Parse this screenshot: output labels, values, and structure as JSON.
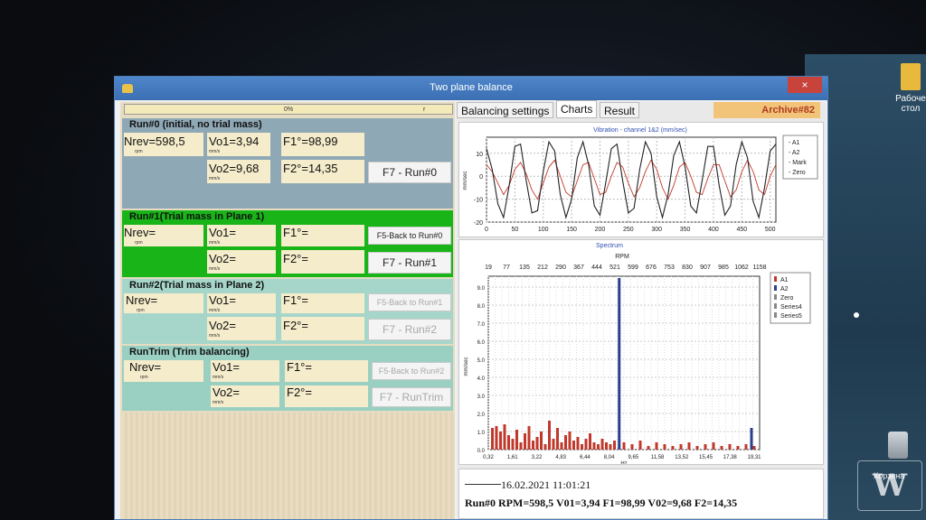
{
  "window": {
    "title": "Two plane balance",
    "close_label": "×"
  },
  "desktop": {
    "icon_label_line1": "Рабоче",
    "icon_label_line2": "стол",
    "recycle_label": "Корзина"
  },
  "progress": {
    "value_percent": 0,
    "label": "0%",
    "tick": "r"
  },
  "run0": {
    "header": "Run#0 (initial, no trial mass)",
    "nrev_label": "Nrev=598,5",
    "nrev_unit": "rpm",
    "vo1_label": "Vo1=",
    "vo1_value": "3,94",
    "vo1_unit": "mm/s",
    "f1_label": "F1°=",
    "f1_value": "98,99",
    "vo2_label": "Vo2=",
    "vo2_value": "9,68",
    "vo2_unit": "mm/s",
    "f2_label": "F2°=",
    "f2_value": "14,35",
    "run_button": "F7 - Run#0"
  },
  "run1": {
    "header": "Run#1(Trial mass in Plane 1)",
    "nrev_label": "Nrev=",
    "nrev_unit": "rpm",
    "vo1_label": "Vo1=",
    "vo1_unit": "mm/s",
    "f1_label": "F1°=",
    "vo2_label": "Vo2=",
    "vo2_unit": "mm/s",
    "f2_label": "F2°=",
    "back_button": "F5-Back to Run#0",
    "run_button": "F7 - Run#1"
  },
  "run2": {
    "header": "Run#2(Trial mass in Plane 2)",
    "nrev_label": "Nrev=",
    "nrev_unit": "rpm",
    "vo1_label": "Vo1=",
    "vo1_unit": "mm/s",
    "f1_label": "F1°=",
    "vo2_label": "Vo2=",
    "vo2_unit": "mm/s",
    "f2_label": "F2°=",
    "back_button": "F5-Back to Run#1",
    "run_button": "F7 - Run#2"
  },
  "runtrim": {
    "header": "RunTrim (Trim balancing)",
    "nrev_label": "Nrev=",
    "nrev_unit": "rpm",
    "vo1_label": "Vo1=",
    "vo1_unit": "mm/s",
    "f1_label": "F1°=",
    "vo2_label": "Vo2=",
    "vo2_unit": "mm/s",
    "f2_label": "F2°=",
    "back_button": "F5-Back to Run#2",
    "run_button": "F7 - RunTrim"
  },
  "tabs": [
    {
      "label": "Balancing settings"
    },
    {
      "label": "Charts"
    },
    {
      "label": "Result"
    }
  ],
  "archive_label": "Archive#82",
  "colors": {
    "series_a1": "#c0392b",
    "series_a2": "#2b3f8f",
    "accent_green": "#18b418"
  },
  "chart_data": [
    {
      "type": "line",
      "title": "Vibration - channel 1&2 (mm/sec)",
      "ylabel": "mm/sec",
      "xlim": [
        0,
        510
      ],
      "ylim": [
        -20,
        17
      ],
      "x_ticks": [
        0,
        50,
        100,
        150,
        200,
        250,
        300,
        350,
        400,
        450,
        500
      ],
      "y_ticks": [
        10,
        0,
        -10,
        -20
      ],
      "legend": [
        "A1",
        "A2",
        "Mark",
        "Zero"
      ],
      "legend_position": "right",
      "grid": true,
      "series": [
        {
          "name": "A1",
          "x": [
            0,
            10,
            20,
            30,
            40,
            50,
            60,
            70,
            80,
            90,
            100,
            110,
            120,
            130,
            140,
            150,
            160,
            170,
            180,
            190,
            200,
            210,
            220,
            230,
            240,
            250,
            260,
            270,
            280,
            290,
            300,
            310,
            320,
            330,
            340,
            350,
            360,
            370,
            380,
            390,
            400,
            410,
            420,
            430,
            440,
            450,
            460,
            470,
            480,
            490,
            500,
            510
          ],
          "values": [
            5,
            2,
            -3,
            -8,
            -4,
            3,
            6,
            1,
            -6,
            -10,
            -3,
            4,
            7,
            0,
            -7,
            -9,
            -2,
            5,
            6,
            -1,
            -8,
            -7,
            0,
            6,
            4,
            -3,
            -9,
            -5,
            2,
            7,
            3,
            -5,
            -10,
            -4,
            4,
            6,
            0,
            -7,
            -8,
            -1,
            5,
            5,
            -2,
            -9,
            -6,
            2,
            7,
            2,
            -6,
            -8,
            0,
            5
          ]
        },
        {
          "name": "A2",
          "x": [
            0,
            10,
            20,
            30,
            40,
            50,
            60,
            70,
            80,
            90,
            100,
            110,
            120,
            130,
            140,
            150,
            160,
            170,
            180,
            190,
            200,
            210,
            220,
            230,
            240,
            250,
            260,
            270,
            280,
            290,
            300,
            310,
            320,
            330,
            340,
            350,
            360,
            370,
            380,
            390,
            400,
            410,
            420,
            430,
            440,
            450,
            460,
            470,
            480,
            490,
            500,
            510
          ],
          "values": [
            12,
            3,
            -12,
            -18,
            -4,
            13,
            14,
            -2,
            -16,
            -15,
            2,
            15,
            11,
            -8,
            -18,
            -10,
            8,
            15,
            5,
            -13,
            -17,
            -3,
            12,
            14,
            -2,
            -16,
            -14,
            3,
            15,
            10,
            -9,
            -18,
            -8,
            9,
            15,
            4,
            -13,
            -16,
            -2,
            13,
            13,
            -4,
            -17,
            -13,
            5,
            15,
            8,
            -11,
            -18,
            -5,
            11,
            14
          ]
        }
      ]
    },
    {
      "type": "bar",
      "title": "Spectrum",
      "xlabel": "Hz",
      "ylabel": "mm/sec",
      "top_axis_label": "RPM",
      "top_ticks": [
        "19",
        "77",
        "135",
        "212",
        "290",
        "367",
        "444",
        "521",
        "599",
        "676",
        "753",
        "830",
        "907",
        "985",
        "1062",
        "1158"
      ],
      "bottom_ticks": [
        "0,32",
        "1,61",
        "3,22",
        "4,83",
        "6,44",
        "8,04",
        "9,65",
        "11,58",
        "13,52",
        "15,45",
        "17,38",
        "19,31"
      ],
      "xlim": [
        0,
        20
      ],
      "ylim": [
        0,
        9.6
      ],
      "y_ticks": [
        0.0,
        1.0,
        2.0,
        3.0,
        4.0,
        5.0,
        6.0,
        7.0,
        8.0,
        9.0
      ],
      "legend": [
        "A1",
        "A2",
        "Zero",
        "Series4",
        "Series5"
      ],
      "legend_position": "right",
      "grid": true,
      "series": [
        {
          "name": "A1",
          "x": [
            0.3,
            0.6,
            0.9,
            1.2,
            1.5,
            1.8,
            2.1,
            2.4,
            2.7,
            3.0,
            3.3,
            3.6,
            3.9,
            4.2,
            4.5,
            4.8,
            5.1,
            5.4,
            5.7,
            6.0,
            6.3,
            6.6,
            6.9,
            7.2,
            7.5,
            7.8,
            8.1,
            8.4,
            8.7,
            9.0,
            9.3,
            10.0,
            10.6,
            11.2,
            11.8,
            12.4,
            13.0,
            13.6,
            14.2,
            14.8,
            15.4,
            16.0,
            16.6,
            17.2,
            17.8,
            18.4,
            19.0,
            19.6
          ],
          "values": [
            1.2,
            1.3,
            1.0,
            1.4,
            0.8,
            0.6,
            1.1,
            0.4,
            0.9,
            1.3,
            0.5,
            0.7,
            1.0,
            0.3,
            1.6,
            0.6,
            1.2,
            0.4,
            0.8,
            1.0,
            0.5,
            0.7,
            0.3,
            0.6,
            0.9,
            0.4,
            0.3,
            0.6,
            0.4,
            0.3,
            0.5,
            0.4,
            0.3,
            0.5,
            0.2,
            0.4,
            0.3,
            0.2,
            0.3,
            0.4,
            0.2,
            0.3,
            0.4,
            0.2,
            0.3,
            0.2,
            0.3,
            0.2
          ]
        },
        {
          "name": "A2",
          "x": [
            9.65,
            19.4
          ],
          "values": [
            9.5,
            1.2
          ]
        }
      ]
    }
  ],
  "result": {
    "date": "16.02.2021 11:01:21",
    "line": "Run#0 RPM=598,5 V01=3,94 F1=98,99 V02=9,68 F2=14,35"
  }
}
